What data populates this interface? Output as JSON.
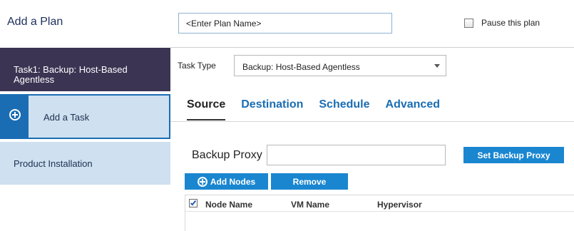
{
  "header": {
    "title": "Add a Plan",
    "plan_name_value": "<Enter Plan Name>",
    "pause_label": "Pause this plan",
    "pause_checked": false
  },
  "sidebar": {
    "items": [
      {
        "label": "Task1: Backup: Host-Based Agentless"
      },
      {
        "label": "Add a Task",
        "icon": "plus-circle-icon"
      },
      {
        "label": "Product Installation"
      }
    ]
  },
  "task_type": {
    "label": "Task Type",
    "selected": "Backup: Host-Based Agentless"
  },
  "tabs": [
    {
      "label": "Source",
      "active": true
    },
    {
      "label": "Destination",
      "active": false
    },
    {
      "label": "Schedule",
      "active": false
    },
    {
      "label": "Advanced",
      "active": false
    }
  ],
  "source": {
    "proxy_label": "Backup Proxy",
    "proxy_value": "",
    "set_proxy_label": "Set Backup Proxy",
    "add_nodes_label": "Add Nodes",
    "remove_label": "Remove"
  },
  "node_table": {
    "select_all_checked": true,
    "columns": [
      "Node Name",
      "VM Name",
      "Hypervisor"
    ],
    "rows": []
  },
  "colors": {
    "accent": "#1a86d0",
    "tab_link": "#1a6db3",
    "sidebar_dark": "#3c3453",
    "sidebar_light": "#cfe0f0"
  }
}
